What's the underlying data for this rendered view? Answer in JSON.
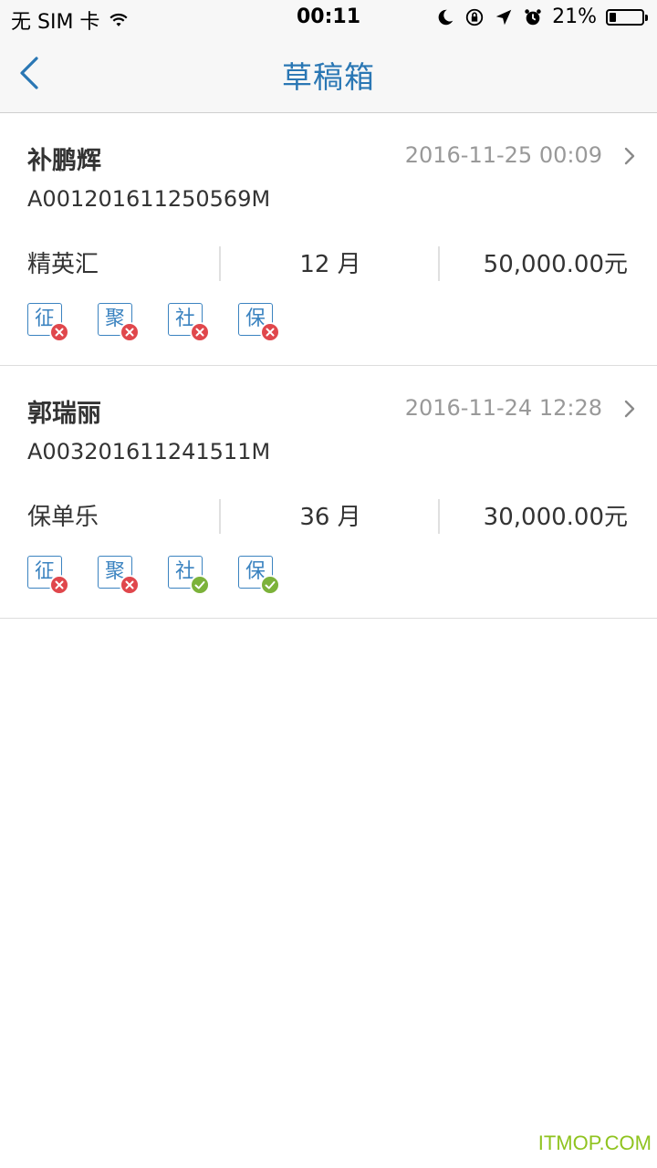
{
  "status_bar": {
    "carrier": "无 SIM 卡",
    "time": "00:11",
    "battery": "21%",
    "battery_level": 0.21,
    "icons": [
      "wifi-icon",
      "moon-icon",
      "rotation-lock-icon",
      "location-icon",
      "alarm-icon",
      "battery-icon"
    ]
  },
  "nav": {
    "title": "草稿箱",
    "back_icon": "chevron-left-icon"
  },
  "drafts": [
    {
      "name": "补鹏辉",
      "date": "2016-11-25 00:09",
      "code": "A001201611250569M",
      "product": "精英汇",
      "term": "12 月",
      "amount": "50,000.00元",
      "tags": [
        {
          "label": "征",
          "ok": false
        },
        {
          "label": "聚",
          "ok": false
        },
        {
          "label": "社",
          "ok": false
        },
        {
          "label": "保",
          "ok": false
        }
      ]
    },
    {
      "name": "郭瑞丽",
      "date": "2016-11-24 12:28",
      "code": "A003201611241511M",
      "product": "保单乐",
      "term": "36 月",
      "amount": "30,000.00元",
      "tags": [
        {
          "label": "征",
          "ok": false
        },
        {
          "label": "聚",
          "ok": false
        },
        {
          "label": "社",
          "ok": true
        },
        {
          "label": "保",
          "ok": true
        }
      ]
    }
  ],
  "colors": {
    "accent": "#2a77b4",
    "error": "#e0474c",
    "success": "#7cb23a"
  },
  "watermark": "ITMOP.COM"
}
